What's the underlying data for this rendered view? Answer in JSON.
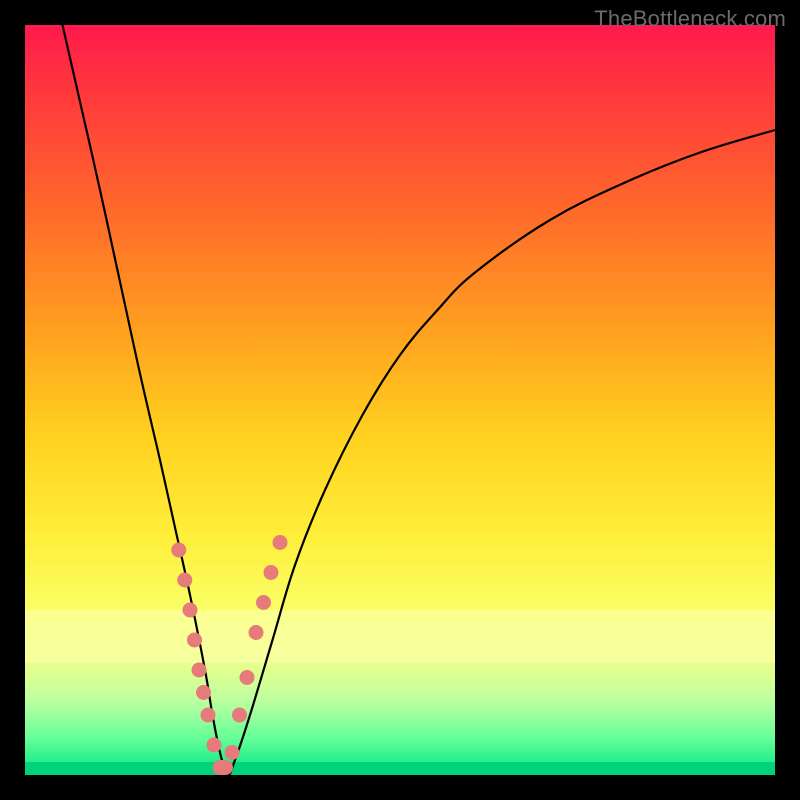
{
  "watermark": "TheBottleneck.com",
  "colors": {
    "frame": "#000000",
    "curve": "#000000",
    "dot": "#e77a7a",
    "gradient_top": "#ff1a4d",
    "gradient_bottom": "#00e584"
  },
  "chart_data": {
    "type": "line",
    "title": "",
    "xlabel": "",
    "ylabel": "",
    "xlim": [
      0,
      100
    ],
    "ylim": [
      0,
      100
    ],
    "grid": false,
    "legend": false,
    "series": [
      {
        "name": "bottleneck-curve",
        "x": [
          5,
          10,
          15,
          18,
          20,
          22,
          24,
          25,
          26,
          27,
          28,
          30,
          33,
          36,
          40,
          45,
          50,
          55,
          60,
          70,
          80,
          90,
          100
        ],
        "y": [
          100,
          78,
          55,
          42,
          33,
          24,
          14,
          8,
          3,
          0,
          2,
          8,
          18,
          28,
          38,
          48,
          56,
          62,
          67,
          74,
          79,
          83,
          86
        ]
      }
    ],
    "highlight_points": {
      "name": "sample-dots",
      "x": [
        20.5,
        21.3,
        22.0,
        22.6,
        23.2,
        23.8,
        24.4,
        25.2,
        26.0,
        26.8,
        27.6,
        28.6,
        29.6,
        30.8,
        31.8,
        32.8,
        34.0
      ],
      "y": [
        30,
        26,
        22,
        18,
        14,
        11,
        8,
        4,
        1,
        1,
        3,
        8,
        13,
        19,
        23,
        27,
        31
      ]
    }
  }
}
